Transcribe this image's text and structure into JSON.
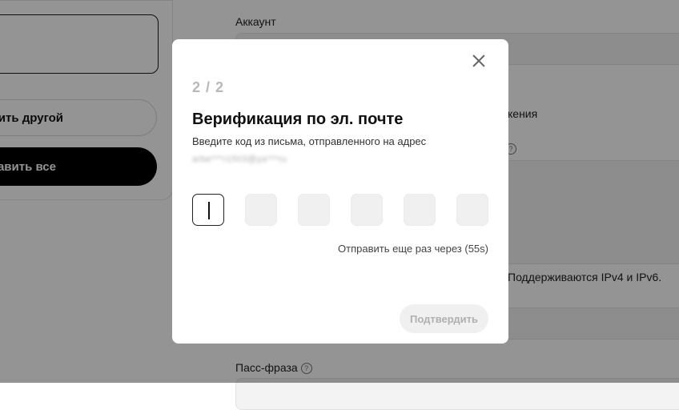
{
  "background": {
    "left_panel": {
      "add_other_label": "ить другой",
      "add_all_label": "авить все"
    },
    "fields": {
      "account_label": "Аккаунт",
      "connection_label_fragment": "кения",
      "ip_support_hint": "Поддерживаются IPv4 и IPv6.",
      "passphrase_label": "Пасс-фраза",
      "help_icon_glyph": "?"
    }
  },
  "modal": {
    "step": "2 / 2",
    "title": "Верификация по эл. почте",
    "subtitle": "Введите код из письма, отправленного на адрес",
    "email_masked": "arbe***r1503@ya***ru",
    "code_cells": [
      "",
      "",
      "",
      "",
      "",
      ""
    ],
    "active_cell_index": 0,
    "resend_text": "Отправить еще раз через (55s)",
    "confirm_label": "Подтвердить",
    "confirm_enabled": false
  },
  "colors": {
    "overlay": "rgba(0,0,0,0.42)",
    "primary_button": "#000000",
    "disabled_button_bg": "#f0f0f0",
    "disabled_button_text": "#b0b0b0"
  }
}
